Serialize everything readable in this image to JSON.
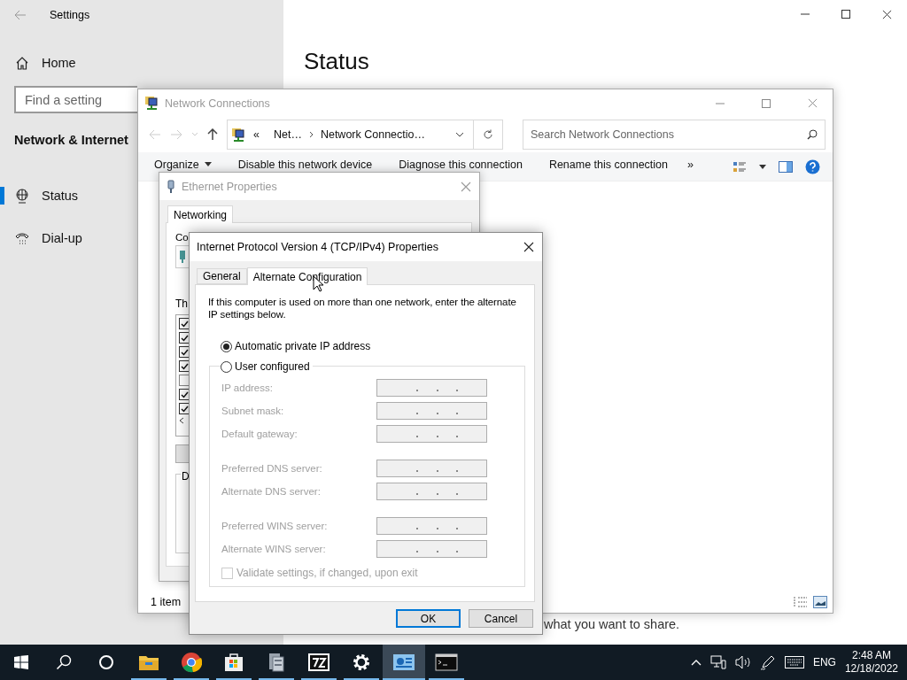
{
  "settings": {
    "title": "Settings",
    "home": "Home",
    "search_placeholder": "Find a setting",
    "section": "Network & Internet",
    "nav": [
      {
        "kind": "status",
        "label": "Status",
        "selected": true
      },
      {
        "kind": "dialup",
        "label": "Dial-up",
        "selected": false
      }
    ],
    "page_title": "Status",
    "page_text": "what you want to share."
  },
  "network_connections": {
    "title": "Network Connections",
    "breadcrumb": [
      "«",
      "Net…",
      "Network Connectio…"
    ],
    "search_placeholder": "Search Network Connections",
    "commands": [
      "Organize",
      "Disable this network device",
      "Diagnose this connection",
      "Rename this connection",
      "»"
    ],
    "status": "1 item"
  },
  "ethernet_properties": {
    "title": "Ethernet Properties",
    "tabs": [
      {
        "label": "Networking",
        "selected": true
      }
    ],
    "connect_label": "Co",
    "items_label": "Th",
    "components": [
      {
        "checked": true
      },
      {
        "checked": true
      },
      {
        "checked": true
      },
      {
        "checked": true
      },
      {
        "checked": false
      },
      {
        "checked": true
      },
      {
        "checked": true
      }
    ],
    "description_label": "D"
  },
  "ipv4_dialog": {
    "title": "Internet Protocol Version 4 (TCP/IPv4) Properties",
    "tabs": [
      {
        "label": "General",
        "selected": false
      },
      {
        "label": "Alternate Configuration",
        "selected": true
      }
    ],
    "intro": "If this computer is used on more than one network, enter the alternate IP settings below.",
    "options": [
      {
        "label": "Automatic private IP address",
        "selected": true
      },
      {
        "label": "User configured",
        "selected": false
      }
    ],
    "field_groups": [
      [
        {
          "label": "IP address:",
          "disabled": true
        },
        {
          "label": "Subnet mask:",
          "disabled": true
        },
        {
          "label": "Default gateway:",
          "disabled": true
        }
      ],
      [
        {
          "label": "Preferred DNS server:",
          "disabled": true
        },
        {
          "label": "Alternate DNS server:",
          "disabled": true
        }
      ],
      [
        {
          "label": "Preferred WINS server:",
          "disabled": true
        },
        {
          "label": "Alternate WINS server:",
          "disabled": true
        }
      ]
    ],
    "validate": {
      "label": "Validate settings, if changed, upon exit",
      "checked": false,
      "disabled": true
    },
    "buttons": [
      {
        "label": "OK",
        "default": true
      },
      {
        "label": "Cancel",
        "default": false
      }
    ]
  },
  "taskbar": {
    "apps": [
      {
        "kind": "explorer",
        "running": true,
        "selected": false
      },
      {
        "kind": "chrome",
        "running": true,
        "selected": false
      },
      {
        "kind": "store",
        "running": true,
        "selected": false
      },
      {
        "kind": "server",
        "running": true,
        "selected": false
      },
      {
        "kind": "sevenzip",
        "running": true,
        "selected": false
      },
      {
        "kind": "gear",
        "running": true,
        "selected": false
      },
      {
        "kind": "netconn",
        "running": true,
        "selected": true
      },
      {
        "kind": "terminal",
        "running": true,
        "selected": false
      }
    ],
    "language": "ENG",
    "time": "2:48 AM",
    "date": "12/18/2022"
  }
}
